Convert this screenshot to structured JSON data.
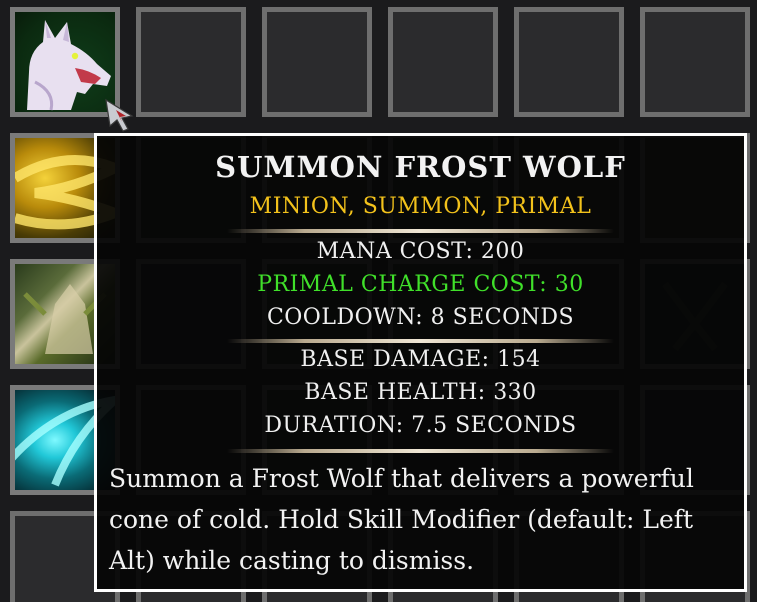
{
  "tooltip": {
    "title": "SUMMON FROST WOLF",
    "tags": "MINION, SUMMON, PRIMAL",
    "mana_cost": "MANA COST: 200",
    "primal_charge_cost": "PRIMAL CHARGE COST: 30",
    "cooldown": "COOLDOWN: 8 SECONDS",
    "base_damage": "BASE DAMAGE: 154",
    "base_health": "BASE HEALTH: 330",
    "duration": "DURATION: 7.5 SECONDS",
    "description": "Summon a Frost Wolf that delivers a powerful cone of cold. Hold Skill Modifier (default: Left Alt) while casting to dismiss."
  },
  "colors": {
    "title": "#f2f2f2",
    "tags": "#f3c21b",
    "primal_cost": "#40e02a",
    "border": "#ffffff"
  },
  "skills": [
    {
      "icon": "frost-wolf-icon"
    },
    {
      "icon": "golden-swirl-icon"
    },
    {
      "icon": "beast-icon"
    },
    {
      "icon": "frost-cone-icon"
    }
  ]
}
